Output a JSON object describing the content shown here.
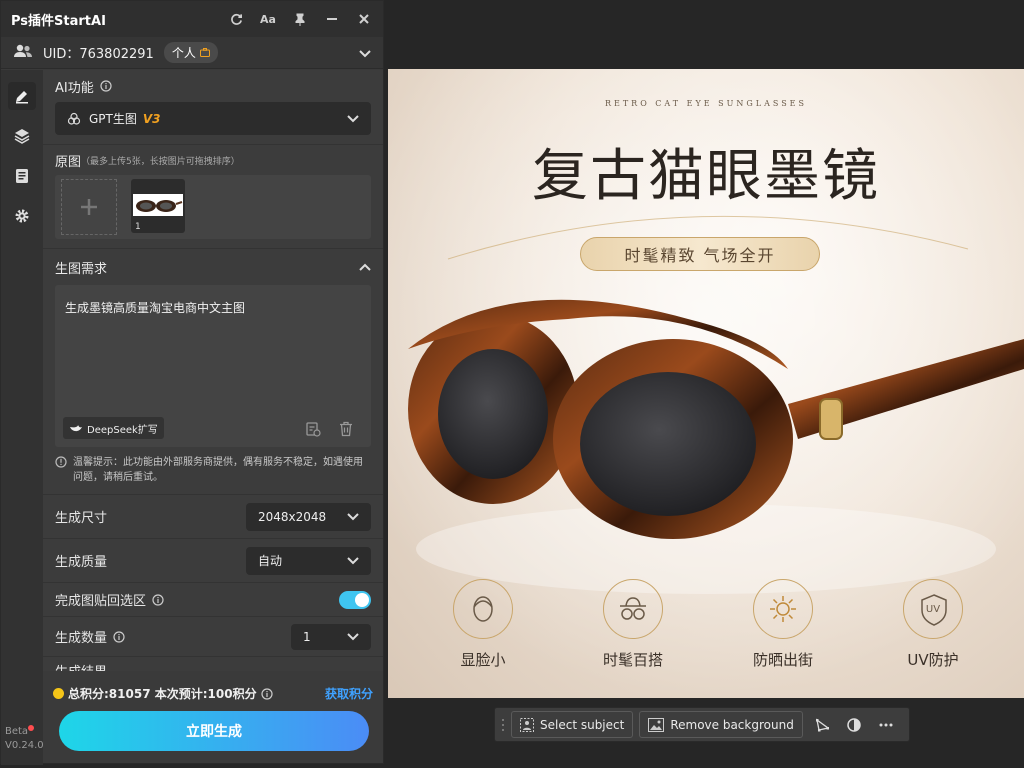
{
  "window": {
    "title": "Ps插件StartAI"
  },
  "user": {
    "uid_text": "UID：763802291",
    "account_type": "个人"
  },
  "sidebar": {
    "items": [
      "edit-icon",
      "layers-icon",
      "document-icon",
      "gear-icon"
    ],
    "beta": "Beta",
    "version": "V0.24.0"
  },
  "ai_function": {
    "label": "AI功能",
    "model": "GPT生图",
    "version_tag": "V3"
  },
  "images": {
    "label": "原图",
    "hint": "（最多上传5张，长按图片可拖拽排序）",
    "count": "1"
  },
  "prompt": {
    "label": "生图需求",
    "text": "生成墨镜高质量淘宝电商中文主图",
    "deepseek_label": "DeepSeek扩写"
  },
  "notice": {
    "text": "温馨提示：此功能由外部服务商提供，偶有服务不稳定，如遇使用问题，请稍后重试。"
  },
  "settings": {
    "size_label": "生成尺寸",
    "size_value": "2048x2048",
    "quality_label": "生成质量",
    "quality_value": "自动",
    "paste_back_label": "完成图贴回选区",
    "paste_back_on": true,
    "count_label": "生成数量",
    "count_value": "1",
    "result_label": "生成结果"
  },
  "footer": {
    "points_text": "总积分:81057  本次预计:100积分",
    "get_points": "获取积分",
    "generate_button": "立即生成"
  },
  "artwork": {
    "subtitle_en": "RETRO CAT EYE SUNGLASSES",
    "headline": "复古猫眼墨镜",
    "tagline": "时髦精致  气场全开",
    "features": [
      {
        "label": "显脸小"
      },
      {
        "label": "时髦百搭"
      },
      {
        "label": "防晒出街"
      },
      {
        "label": "UV防护",
        "icon_text": "UV"
      }
    ]
  },
  "context_toolbar": {
    "select_subject": "Select subject",
    "remove_background": "Remove background"
  },
  "colors": {
    "accent_gradient_start": "#1ed6e8",
    "accent_gradient_end": "#4b8cf6",
    "points_coin": "#f5c518",
    "get_points_link": "#3fa2ff",
    "version_tag": "#f0a020",
    "toggle_on": "#3fc5f0"
  }
}
